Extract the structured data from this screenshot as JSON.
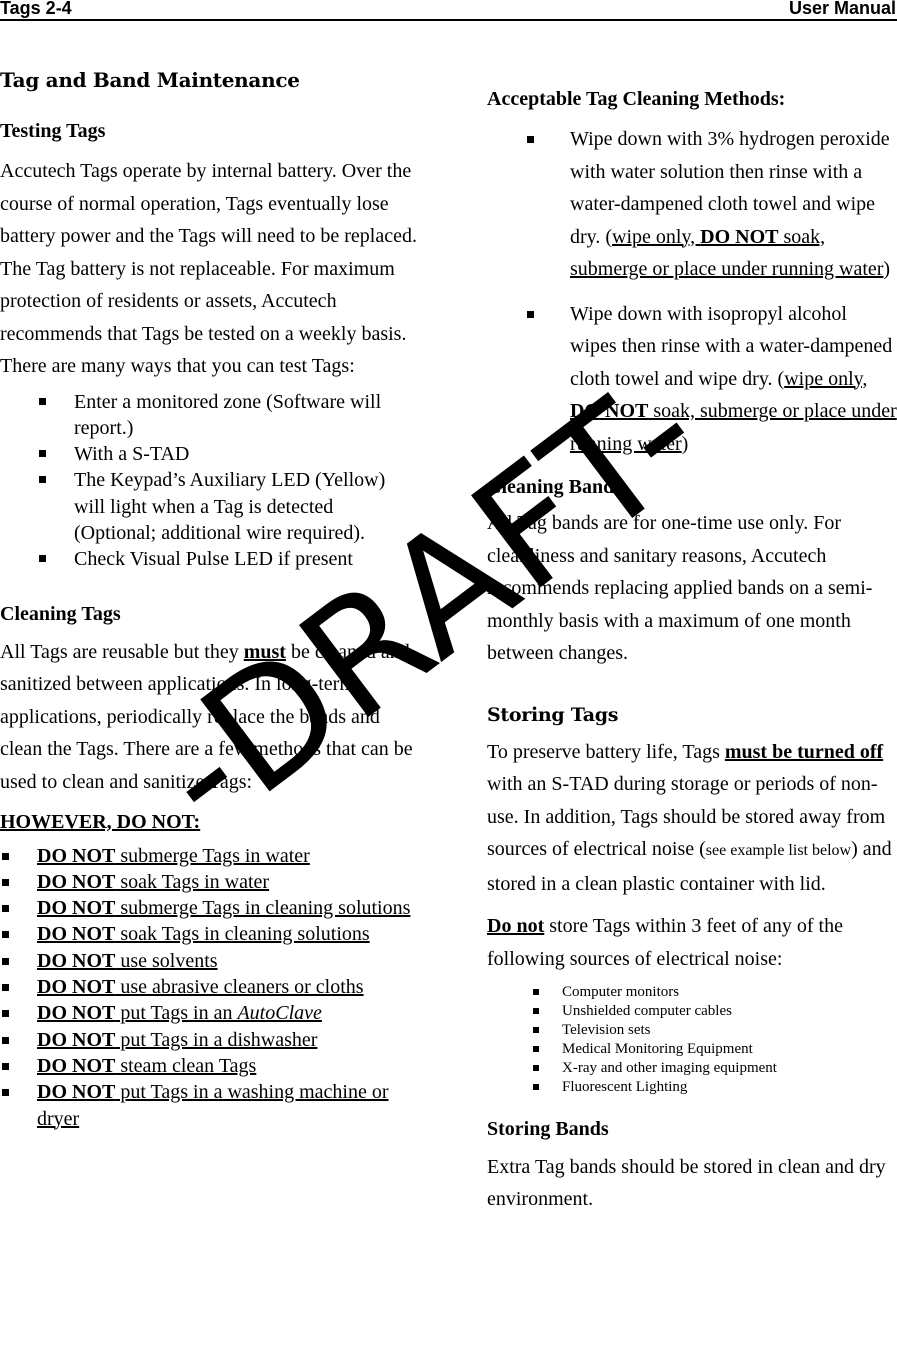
{
  "header": {
    "left": "Tags 2-4",
    "right": "User Manual"
  },
  "left": {
    "title": "Tag and Band Maintenance",
    "testing": {
      "heading": "Testing Tags",
      "body": "Accutech Tags operate by internal battery. Over the course of normal operation, Tags eventually lose battery power and the Tags will need to be replaced. The Tag battery is not replaceable. For maximum protection of residents or assets, Accutech recommends that Tags be tested on a weekly basis. There are many ways that you can test Tags:",
      "items": [
        "Enter a monitored zone (Software will report.)",
        "With a S-TAD",
        "The Keypad’s Auxiliary LED (Yellow) will light when a Tag is detected (Optional; additional wire required).",
        "Check Visual Pulse LED if present"
      ]
    },
    "cleaning": {
      "heading": "Cleaning Tags",
      "body_pre": "All Tags are reusable but they ",
      "body_em": "must",
      "body_post": " be cleaned and sanitized between applications. In long-term applications, periodically replace the bands and clean the Tags. There are a few methods that can be used to clean and sanitize Tags:",
      "however": "HOWEVER, DO NOT:",
      "donot_prefix": "DO NOT",
      "donot_items": [
        {
          "text": " submerge Tags in water"
        },
        {
          "text": " soak Tags in water"
        },
        {
          "text": " submerge Tags in cleaning solutions"
        },
        {
          "text": " soak Tags in cleaning solutions"
        },
        {
          "text": " use solvents"
        },
        {
          "text": " use abrasive cleaners or cloths"
        },
        {
          "text": " put Tags in an ",
          "italic": "AutoClave"
        },
        {
          "text": " put Tags in a dishwasher"
        },
        {
          "text": " steam clean Tags"
        },
        {
          "text": " put Tags in a washing machine or dryer"
        }
      ]
    }
  },
  "right": {
    "acceptable": {
      "heading": "Acceptable Tag Cleaning Methods:",
      "items": [
        {
          "pre": "Wipe down with 3% hydrogen peroxide with water solution then rinse with a water-dampened cloth towel and wipe dry. (",
          "u1": "wipe only, ",
          "ub": "DO NOT",
          "u2": " soak, submerge or place under running water",
          "post": ")"
        },
        {
          "pre": "Wipe down with isopropyl alcohol wipes then rinse with a water-dampened cloth towel and wipe dry. (",
          "u1": "wipe only, ",
          "ub": "DO NOT",
          "u2": " soak, submerge or place under running water",
          "post": ")"
        }
      ]
    },
    "cleaning_bands": {
      "heading": "Cleaning Bands",
      "body": "All Tag bands are for one-time use only. For cleanliness and sanitary reasons, Accutech recommends replacing applied bands on a semi-monthly basis with a maximum of one month between changes."
    },
    "storing_tags": {
      "heading": "Storing Tags",
      "p1_pre": "To preserve battery life, Tags ",
      "p1_em": "must be turned off",
      "p1_mid": " with an S-TAD during storage or periods of non-use. In addition, Tags should be stored away from sources of electrical noise (",
      "p1_small": "see example list below",
      "p1_post": ") and stored in a clean plastic container with lid.",
      "p2_em": "Do not",
      "p2_post": " store Tags within 3 feet of any of the following sources of electrical noise:",
      "noise_items": [
        "Computer monitors",
        "Unshielded computer cables",
        "Television sets",
        "Medical Monitoring Equipment",
        "X-ray and other imaging equipment",
        "Fluorescent Lighting"
      ]
    },
    "storing_bands": {
      "heading": "Storing Bands",
      "body": "Extra Tag bands should be stored in clean and dry environment."
    }
  },
  "watermark": "-DRAFT-"
}
